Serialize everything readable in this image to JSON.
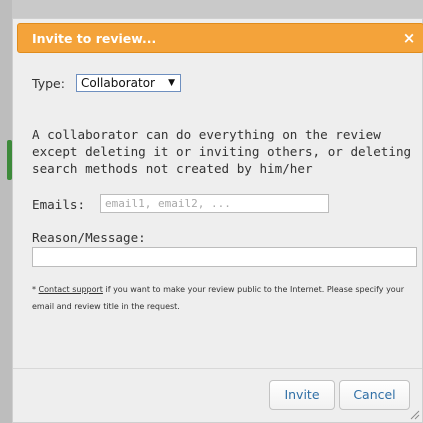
{
  "dialog": {
    "title": "Invite to review...",
    "close_label": "×"
  },
  "type": {
    "label": "Type:",
    "selected": "Collaborator",
    "caret": "▼"
  },
  "description": "A collaborator can do everything on the review except deleting it or inviting others, or deleting search methods not created by him/her",
  "emails": {
    "label": "Emails:",
    "placeholder": "email1, email2, ...",
    "value": ""
  },
  "reason": {
    "label": "Reason/Message:",
    "value": ""
  },
  "footnote": {
    "asterisk": "*",
    "link_text": "Contact support",
    "text": "if you want to make your review public to the Internet. Please specify your email and review title in the request."
  },
  "buttons": {
    "invite": "Invite",
    "cancel": "Cancel"
  },
  "colors": {
    "titlebar": "#f4a33a",
    "button_text": "#2f6fa6",
    "dialog_bg": "#eeeeee"
  },
  "icons": {
    "close": "close-icon",
    "dropdown": "chevron-down-icon",
    "resize": "resize-grip-icon"
  }
}
